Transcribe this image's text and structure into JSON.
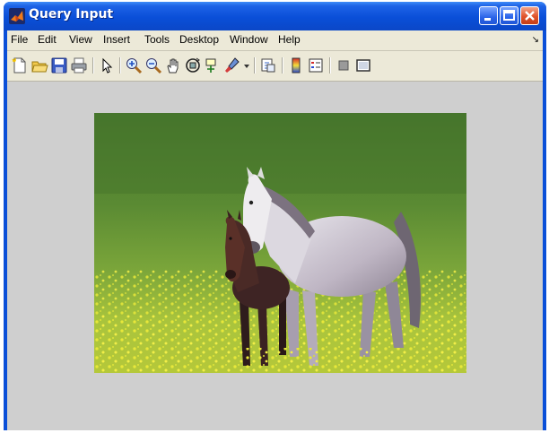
{
  "window": {
    "title": "Query Input"
  },
  "menu": {
    "items": [
      {
        "label": "File"
      },
      {
        "label": "Edit"
      },
      {
        "label": "View"
      },
      {
        "label": "Insert"
      },
      {
        "label": "Tools"
      },
      {
        "label": "Desktop"
      },
      {
        "label": "Window"
      },
      {
        "label": "Help"
      }
    ],
    "overflow_glyph": "↘"
  },
  "toolbar": {
    "buttons": [
      "new-figure-icon",
      "open-file-icon",
      "save-icon",
      "print-icon",
      "select-arrow-icon",
      "zoom-in-icon",
      "zoom-out-icon",
      "pan-hand-icon",
      "rotate-3d-icon",
      "data-cursor-icon",
      "brush-icon",
      "dropdown-arrow-icon",
      "link-plot-icon",
      "colorbar-icon",
      "legend-icon",
      "hide-plot-tools-icon",
      "show-plot-tools-icon"
    ]
  },
  "figure": {
    "image": "photo of a grey mare and dark brown foal standing in a green meadow with yellow flowers"
  },
  "colors": {
    "titlebar": "#0a4fd8",
    "figure_bg": "#cfcfcf",
    "menubar": "#ece9d8",
    "close_button": "#e0522a"
  }
}
